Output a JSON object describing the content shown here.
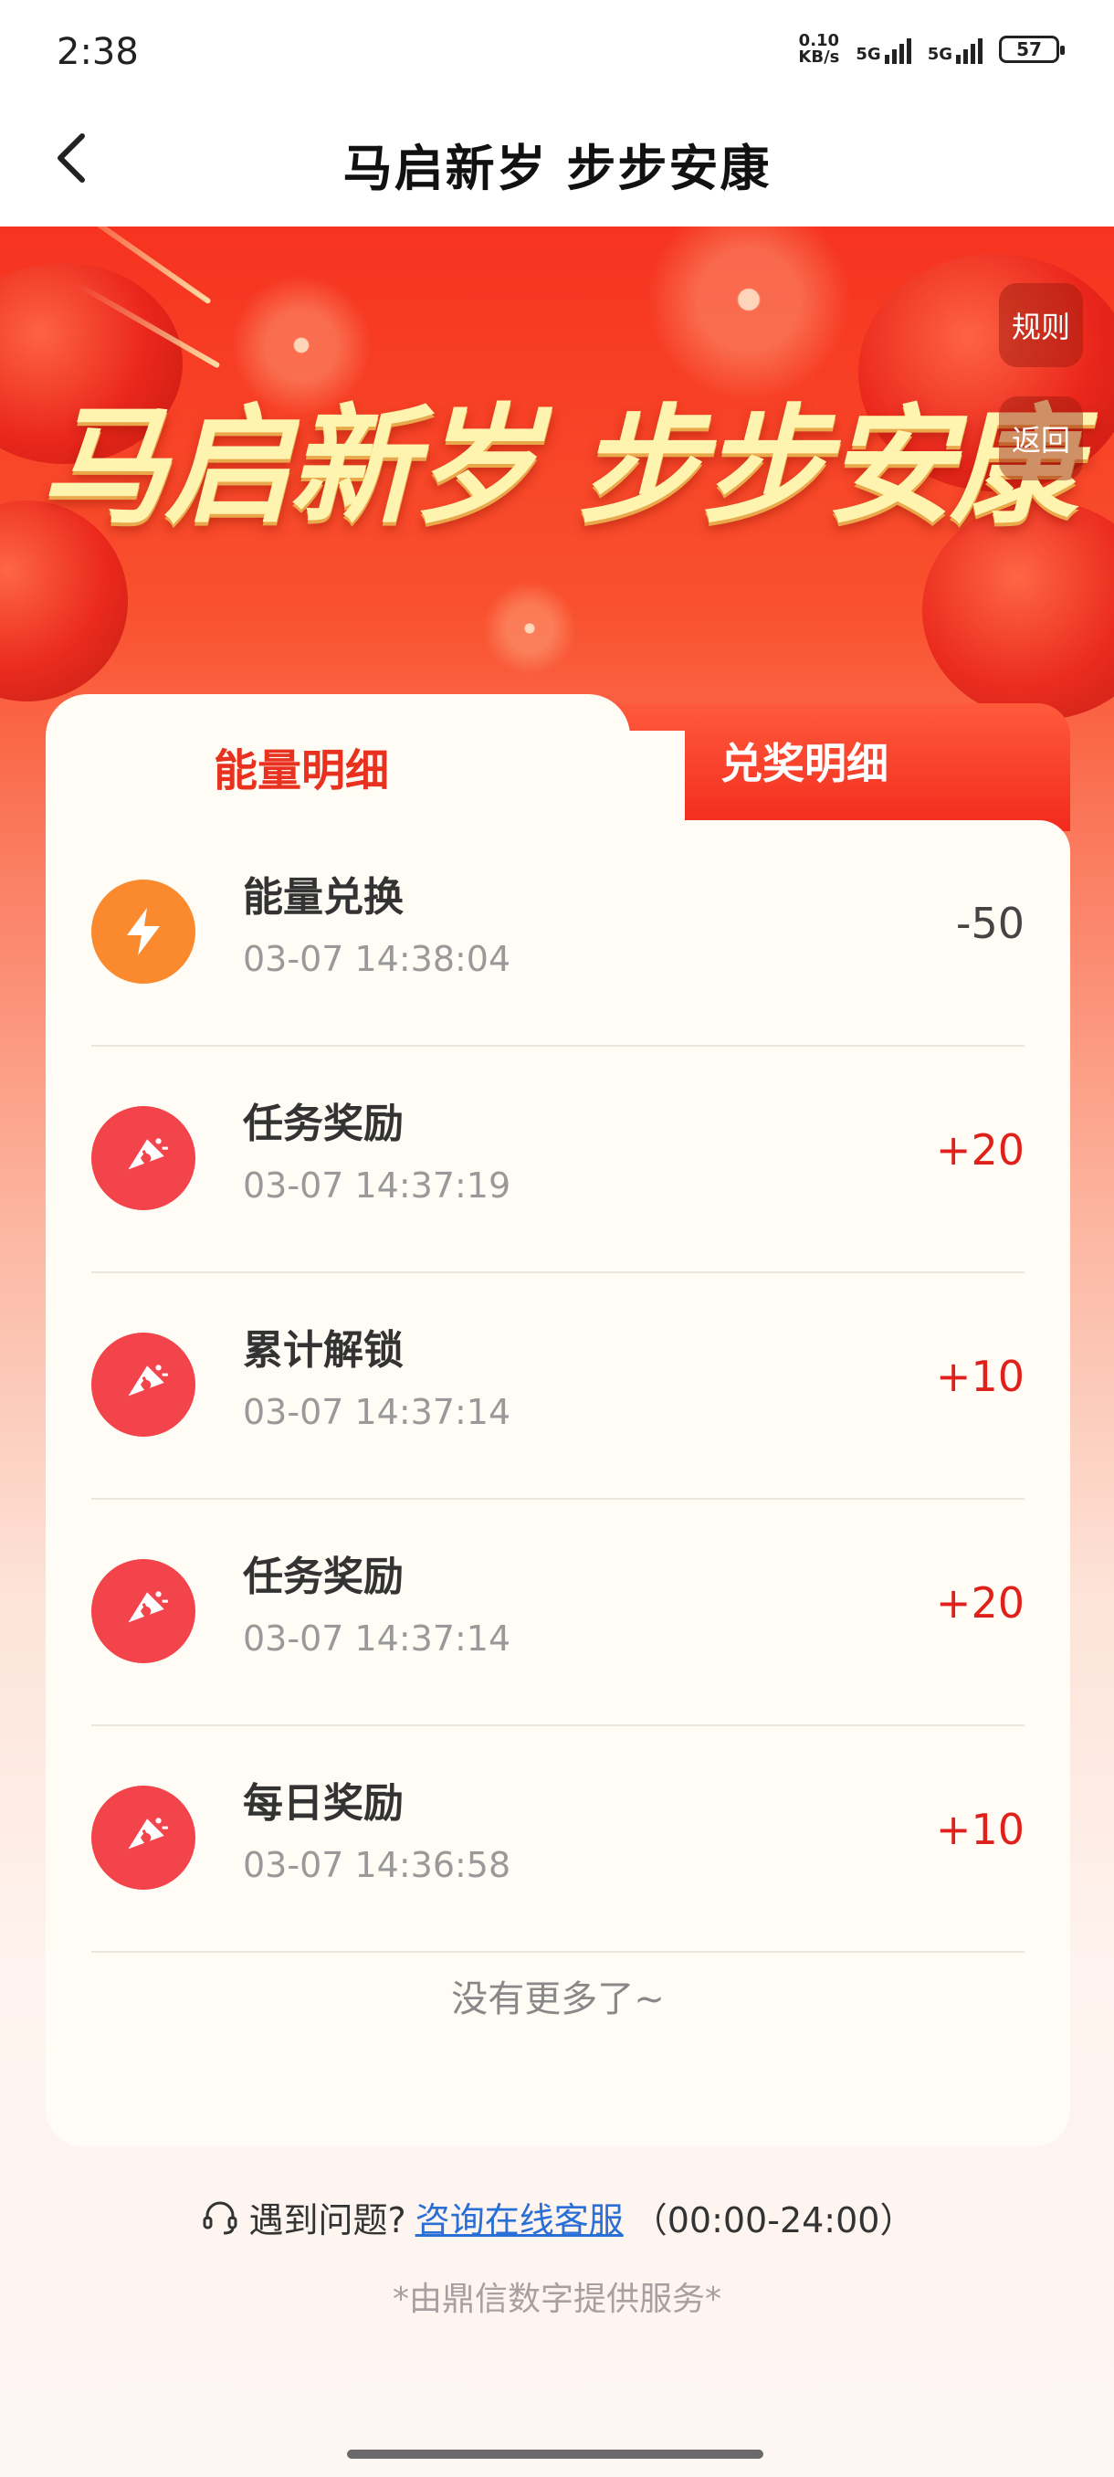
{
  "status_bar": {
    "time": "2:38",
    "net_speed_value": "0.10",
    "net_speed_unit": "KB/s",
    "sim1": "5G",
    "sim2": "5G",
    "battery": "57"
  },
  "nav": {
    "title": "马启新岁 步步安康",
    "back_icon": "chevron-left-icon"
  },
  "hero": {
    "title": "马启新岁 步步安康",
    "rules_label": "规则",
    "return_label": "返回"
  },
  "tabs": {
    "active": "能量明细",
    "inactive": "兑奖明细"
  },
  "records": [
    {
      "title": "能量兑换",
      "time": "03-07 14:38:04",
      "amount": "-50",
      "icon": "lightning-icon",
      "positive": false
    },
    {
      "title": "任务奖励",
      "time": "03-07 14:37:19",
      "amount": "+20",
      "icon": "reward-icon",
      "positive": true
    },
    {
      "title": "累计解锁",
      "time": "03-07 14:37:14",
      "amount": "+10",
      "icon": "reward-icon",
      "positive": true
    },
    {
      "title": "任务奖励",
      "time": "03-07 14:37:14",
      "amount": "+20",
      "icon": "reward-icon",
      "positive": true
    },
    {
      "title": "每日奖励",
      "time": "03-07 14:36:58",
      "amount": "+10",
      "icon": "reward-icon",
      "positive": true
    }
  ],
  "list_end": "没有更多了~",
  "footer": {
    "question": "遇到问题?",
    "link": "咨询在线客服",
    "hours": "（00:00-24:00）",
    "powered": "*由鼎信数字提供服务*"
  },
  "colors": {
    "accent_red": "#e8321f",
    "positive_amount": "#e0201a",
    "lightning_icon_bg": "#fb8a2e",
    "reward_icon_bg": "#f3434b"
  }
}
